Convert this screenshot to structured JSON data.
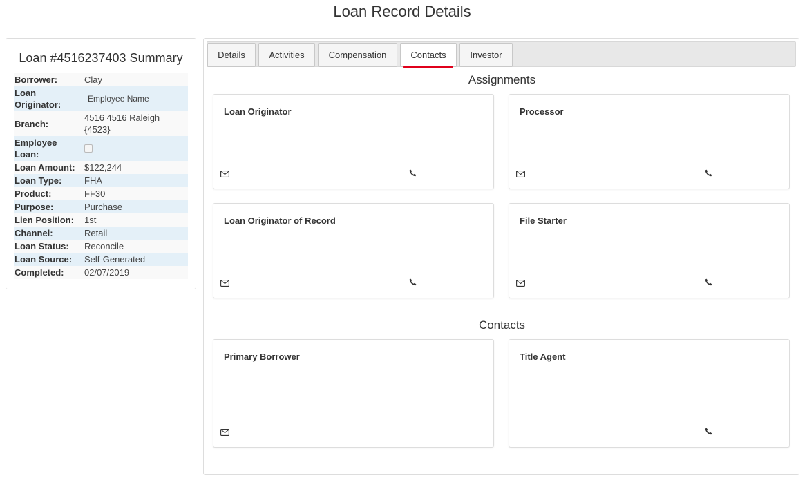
{
  "page": {
    "title": "Loan Record Details"
  },
  "summary": {
    "title": "Loan #4516237403 Summary",
    "rows": {
      "borrower": {
        "label": "Borrower:",
        "value": "Clay"
      },
      "loan_originator": {
        "label": "Loan Originator:",
        "value": "Employee Name"
      },
      "branch": {
        "label": "Branch:",
        "value": "4516 4516 Raleigh {4523}"
      },
      "employee_loan": {
        "label": "Employee Loan:",
        "checked": false
      },
      "loan_amount": {
        "label": "Loan Amount:",
        "value": "$122,244"
      },
      "loan_type": {
        "label": "Loan Type:",
        "value": "FHA"
      },
      "product": {
        "label": "Product:",
        "value": "FF30"
      },
      "purpose": {
        "label": "Purpose:",
        "value": "Purchase"
      },
      "lien_position": {
        "label": "Lien Position:",
        "value": "1st"
      },
      "channel": {
        "label": "Channel:",
        "value": "Retail"
      },
      "loan_status": {
        "label": "Loan Status:",
        "value": "Reconcile"
      },
      "loan_source": {
        "label": "Loan Source:",
        "value": "Self-Generated"
      },
      "completed": {
        "label": "Completed:",
        "value": "02/07/2019"
      }
    }
  },
  "tabs": {
    "details": "Details",
    "activities": "Activities",
    "compensation": "Compensation",
    "contacts": "Contacts",
    "investor": "Investor",
    "active": "Contacts"
  },
  "assignments": {
    "title": "Assignments",
    "cards": {
      "loan_originator": "Loan Originator",
      "processor": "Processor",
      "loan_originator_of_record": "Loan Originator of Record",
      "file_starter": "File Starter"
    }
  },
  "contacts": {
    "title": "Contacts",
    "cards": {
      "primary_borrower": "Primary Borrower",
      "title_agent": "Title Agent"
    }
  },
  "icons": {
    "email": "envelope-icon",
    "phone": "phone-icon"
  },
  "colors": {
    "active_tab_underline": "#e0001b",
    "alt_row": "#e4f0f8"
  }
}
